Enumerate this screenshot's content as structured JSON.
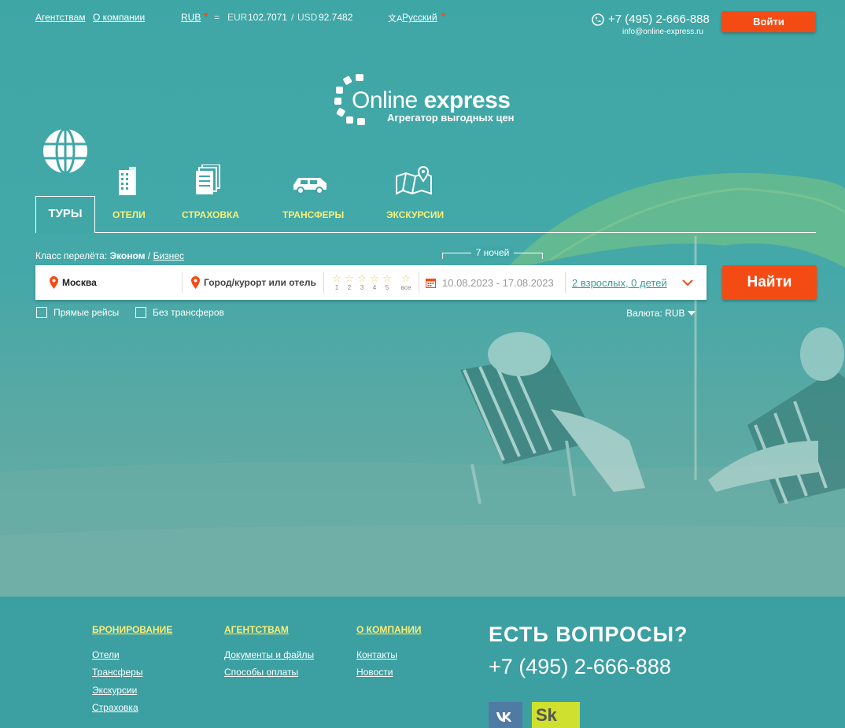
{
  "topbar": {
    "agents_link": "Агентствам",
    "about_link": "О компании",
    "currency_selected": "RUB",
    "equals": "=",
    "eur_label": "EUR",
    "eur_value": "102.7071",
    "separator": "/",
    "usd_label": "USD",
    "usd_value": "92.7482",
    "language": "Русский",
    "phone": "+7 (495) 2-666-888",
    "email": "info@online-express.ru",
    "login_label": "Войти"
  },
  "logo": {
    "title_light": "Online",
    "title_bold": "express",
    "subtitle": "Агрегатор выгодных цен"
  },
  "tabs": [
    {
      "label": "ТУРЫ",
      "icon": "globe-icon",
      "active": true
    },
    {
      "label": "ОТЕЛИ",
      "icon": "hotel-building-icon"
    },
    {
      "label": "СТРАХОВКА",
      "icon": "documents-icon"
    },
    {
      "label": "ТРАНСФЕРЫ",
      "icon": "car-icon"
    },
    {
      "label": "ЭКСКУРСИИ",
      "icon": "map-pin-icon"
    }
  ],
  "flight_class": {
    "label": "Класс перелёта:",
    "economy": "Эконом",
    "slash": "/",
    "business": "Бизнес"
  },
  "nights": "7 ночей",
  "search": {
    "from_value": "Москва",
    "to_placeholder": "Город/курорт или отель",
    "star_numbers": [
      "1",
      "2",
      "3",
      "4",
      "5"
    ],
    "star_all": "все",
    "dates": "10.08.2023 - 17.08.2023",
    "guests": "2 взрослых, 0 детей",
    "find_label": "Найти"
  },
  "options": {
    "direct_flights": "Прямые рейсы",
    "no_transfers": "Без трансферов",
    "currency_label": "Валюта: RUB"
  },
  "footer": {
    "booking": {
      "title": "БРОНИРОВАНИЕ",
      "links": [
        "Отели",
        "Трансферы",
        "Экскурсии",
        "Страховка"
      ]
    },
    "agents": {
      "title": "АГЕНТСТВАМ",
      "links": [
        "Документы и файлы",
        "Способы оплаты"
      ]
    },
    "company": {
      "title": "О КОМПАНИИ",
      "links": [
        "Контакты",
        "Новости"
      ]
    },
    "questions_title": "ЕСТЬ ВОПРОСЫ?",
    "questions_phone": "+7 (495) 2-666-888",
    "social_icon": "vk-icon",
    "partner_logo": "Sk"
  },
  "colors": {
    "accent_orange": "#f44b14",
    "tab_yellow": "#f7ef79",
    "teal": "#40a6a6"
  }
}
